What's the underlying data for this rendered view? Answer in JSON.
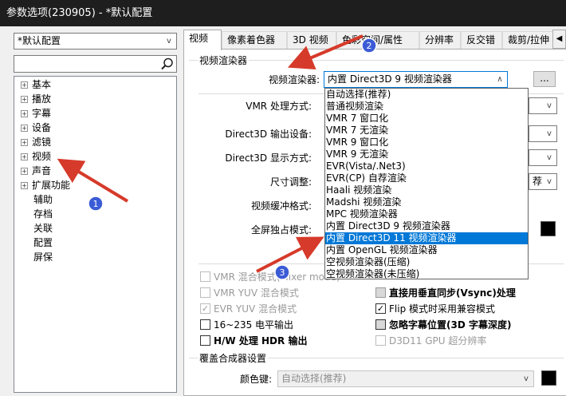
{
  "window": {
    "title": "参数选项(230905) - *默认配置"
  },
  "sidebar": {
    "profile_combo": "*默认配置",
    "search": {
      "value": "",
      "placeholder": ""
    },
    "tree": [
      {
        "label": "基本",
        "expander": "+"
      },
      {
        "label": "播放",
        "expander": "+"
      },
      {
        "label": "字幕",
        "expander": "+"
      },
      {
        "label": "设备",
        "expander": "+"
      },
      {
        "label": "滤镜",
        "expander": "+"
      },
      {
        "label": "视频",
        "expander": "+"
      },
      {
        "label": "声音",
        "expander": "+"
      },
      {
        "label": "扩展功能",
        "expander": "+"
      },
      {
        "label": "辅助",
        "expander": ""
      },
      {
        "label": "存档",
        "expander": ""
      },
      {
        "label": "关联",
        "expander": ""
      },
      {
        "label": "配置",
        "expander": ""
      },
      {
        "label": "屏保",
        "expander": ""
      }
    ]
  },
  "tabs": [
    "视频",
    "像素着色器",
    "3D 视频",
    "色彩空间/属性",
    "分辨率",
    "反交错",
    "裁剪/拉伸"
  ],
  "tab_scroll": "◀",
  "video_renderer_group": {
    "title": "视频渲染器",
    "renderer_label": "视频渲染器:",
    "renderer_value": "内置 Direct3D 9 视频渲染器",
    "more_button": "...",
    "rows": [
      {
        "label": "VMR 处理方式:"
      },
      {
        "label": "Direct3D 输出设备:"
      },
      {
        "label": "Direct3D 显示方式:"
      },
      {
        "label": "尺寸调整:"
      },
      {
        "label": "视频缓冲格式:"
      },
      {
        "label": "全屏独占模式:"
      }
    ],
    "size_combo_tail": "荐"
  },
  "renderer_options": [
    "自动选择(推荐)",
    "普通视频渲染",
    "VMR 7 窗口化",
    "VMR 7 无渲染",
    "VMR 9 窗口化",
    "VMR 9 无渲染",
    "EVR(Vista/.Net3)",
    "EVR(CP) 自荐渲染",
    "Haali 视频渲染",
    "Madshi 视频渲染",
    "MPC 视频渲染器",
    "内置 Direct3D 9 视频渲染器",
    "内置 Direct3D 11 视频渲染器",
    "内置 OpenGL 视频渲染器",
    "空视频渲染器(压缩)",
    "空视频渲染器(未压缩)"
  ],
  "highlighted_option_index": 12,
  "checkboxes_left": [
    {
      "label": "VMR 混合模式(Mixer mode)",
      "checked": false,
      "disabled": true,
      "bold": false
    },
    {
      "label": "VMR YUV 混合模式",
      "checked": false,
      "disabled": true,
      "bold": false
    },
    {
      "label": "EVR YUV 混合模式",
      "checked": true,
      "disabled": true,
      "bold": false
    },
    {
      "label": "16~235 电平输出",
      "checked": false,
      "disabled": false,
      "bold": false
    },
    {
      "label": "H/W 处理 HDR 输出",
      "checked": false,
      "disabled": false,
      "bold": true
    }
  ],
  "checkboxes_right": [
    {
      "label": "直接用垂直同步(Vsync)处理",
      "checked": false,
      "disabled": false,
      "bold": true,
      "grey_box": true
    },
    {
      "label": "Flip 模式时采用兼容模式",
      "checked": true,
      "disabled": false,
      "bold": false,
      "grey_box": false
    },
    {
      "label": "忽略字幕位置(3D 字幕深度)",
      "checked": false,
      "disabled": false,
      "bold": true,
      "grey_box": true
    },
    {
      "label": "D3D11 GPU 超分辨率",
      "checked": false,
      "disabled": true,
      "bold": false,
      "grey_box": false
    }
  ],
  "overlay_group": {
    "title": "覆盖合成器设置",
    "color_key_label": "颜色键:",
    "color_key_value": "自动选择(推荐)"
  },
  "annotations": [
    {
      "number": "1",
      "color": "#3b5bd6"
    },
    {
      "number": "2",
      "color": "#3b5bd6"
    },
    {
      "number": "3",
      "color": "#3b5bd6"
    }
  ],
  "colors": {
    "titlebar": "#1e1e1e",
    "selection": "#0078d7",
    "arrow": "#d63a2a",
    "badge": "#3b5bd6"
  }
}
